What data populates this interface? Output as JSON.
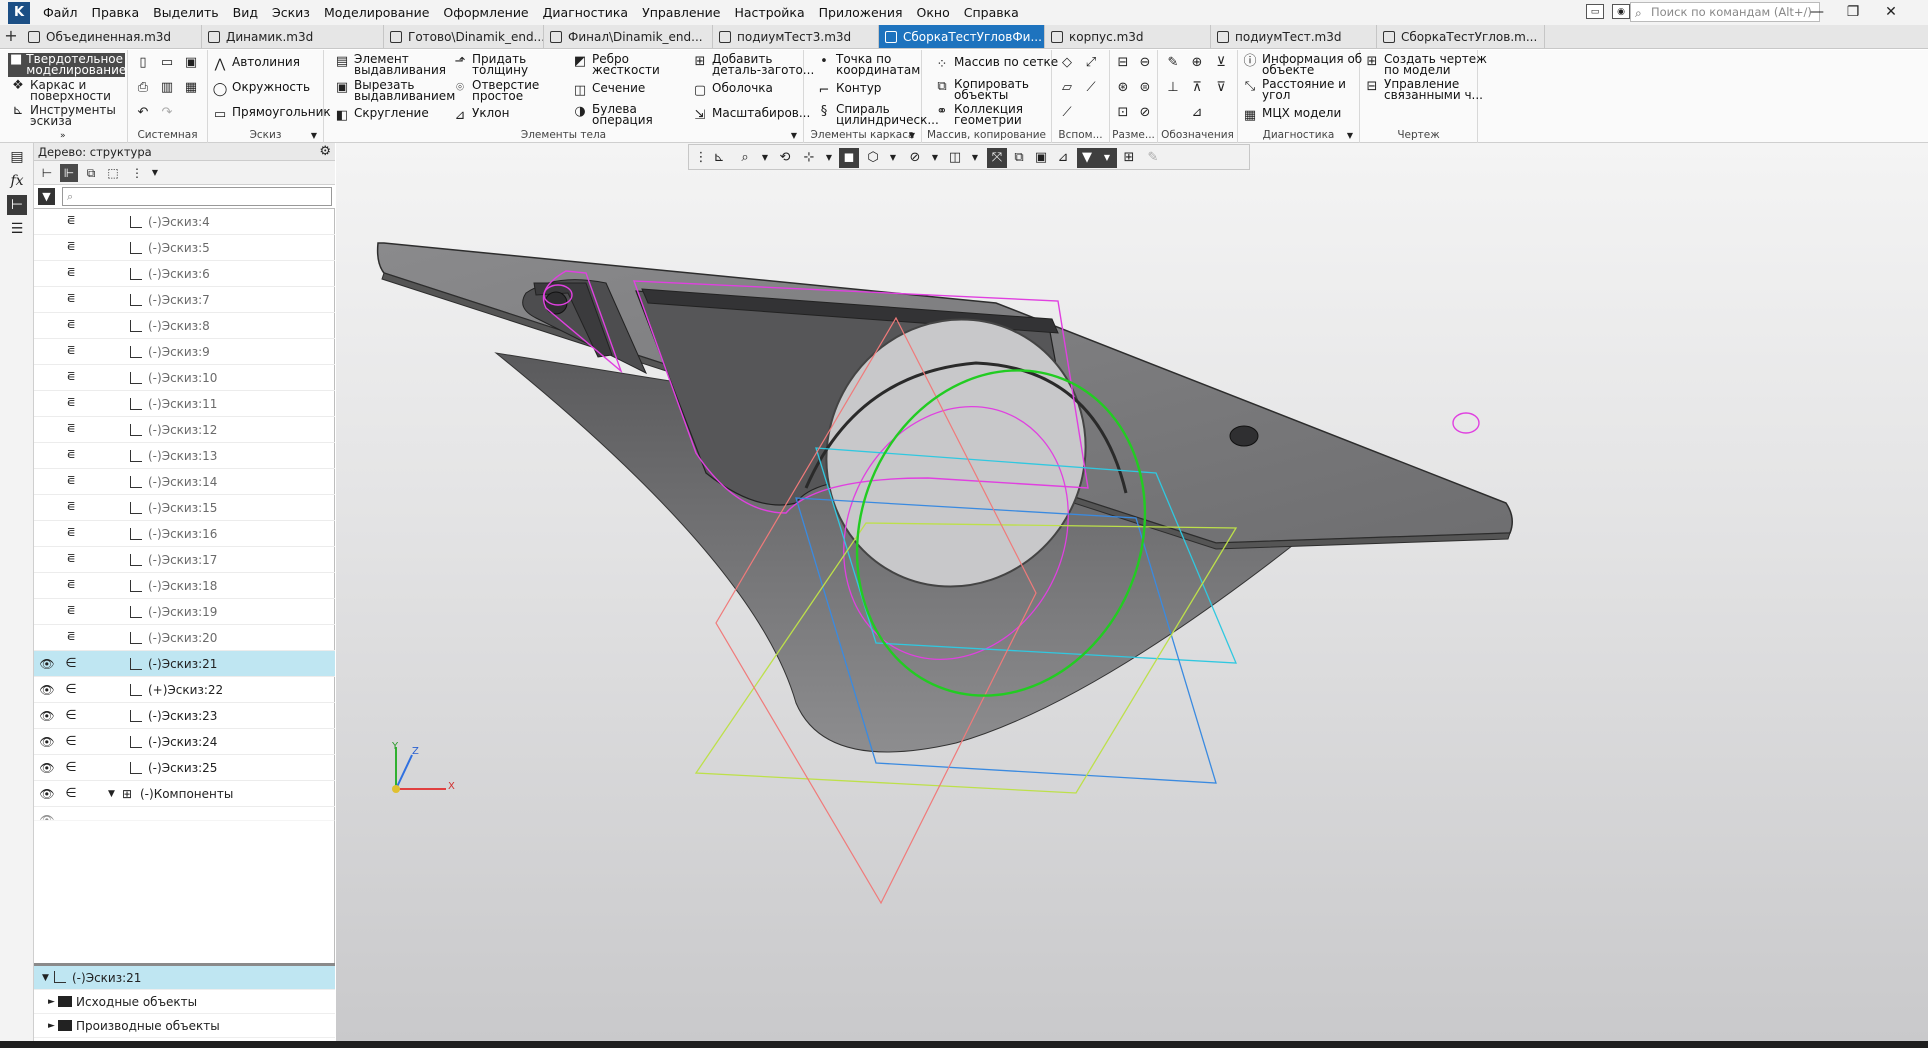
{
  "menu": {
    "items": [
      "Файл",
      "Правка",
      "Выделить",
      "Вид",
      "Эскиз",
      "Моделирование",
      "Оформление",
      "Диагностика",
      "Управление",
      "Настройка",
      "Приложения",
      "Окно",
      "Справка"
    ],
    "search_placeholder": "Поиск по командам (Alt+/)"
  },
  "tabs": [
    {
      "label": "Объединенная.m3d",
      "active": false
    },
    {
      "label": "Динамик.m3d",
      "active": false
    },
    {
      "label": "Готово\\Dinamik_end...",
      "active": false
    },
    {
      "label": "Финал\\Dinamik_end...",
      "active": false
    },
    {
      "label": "подиумТест3.m3d",
      "active": false
    },
    {
      "label": "СборкаТестУгловФи...",
      "active": true
    },
    {
      "label": "корпус.m3d",
      "active": false
    },
    {
      "label": "подиумТест.m3d",
      "active": false
    },
    {
      "label": "СборкаТестУглов.m...",
      "active": false
    }
  ],
  "ribbon": {
    "modes": {
      "solid": [
        "Твердотельное",
        "моделирование"
      ],
      "wire": [
        "Каркас и",
        "поверхности"
      ],
      "sketch_tools": [
        "Инструменты",
        "эскиза"
      ]
    },
    "sketch": {
      "autoline": "Автолиния",
      "circle": "Окружность",
      "rectangle": "Прямоугольник"
    },
    "body": {
      "extrude": [
        "Элемент",
        "выдавливания"
      ],
      "cut_extrude": [
        "Вырезать",
        "выдавливанием"
      ],
      "fillet": "Скругление",
      "thicken": [
        "Придать",
        "толщину"
      ],
      "hole": [
        "Отверстие",
        "простое"
      ],
      "draft": "Уклон",
      "rib": [
        "Ребро",
        "жесткости"
      ],
      "section": "Сечение",
      "boolean": [
        "Булева",
        "операция"
      ],
      "add_blank": [
        "Добавить",
        "деталь-загото..."
      ],
      "shell": "Оболочка",
      "scale": "Масштабиров..."
    },
    "frame": {
      "point": [
        "Точка по",
        "координатам"
      ],
      "contour": "Контур",
      "spiral": [
        "Спираль",
        "цилиндрическ..."
      ]
    },
    "array": {
      "grid": "Массив по сетке",
      "copy": [
        "Копировать",
        "объекты"
      ],
      "collection": [
        "Коллекция",
        "геометрии"
      ]
    },
    "diag": {
      "info": [
        "Информация об",
        "объекте"
      ],
      "distance": [
        "Расстояние и",
        "угол"
      ],
      "mcx": "МЦХ модели"
    },
    "drawing": {
      "create": [
        "Создать чертеж",
        "по модели"
      ],
      "manage": [
        "Управление",
        "связанными ч..."
      ]
    },
    "groups": {
      "system": "Системная",
      "sketch": "Эскиз",
      "body": "Элементы тела",
      "frame": "Элементы каркаса",
      "array": "Массив, копирование",
      "aux": "Вспом...",
      "dim": "Разме...",
      "notation": "Обозначения",
      "diag": "Диагностика",
      "drawing": "Чертеж"
    }
  },
  "tree": {
    "header": "Дерево: структура",
    "search_placeholder": "",
    "items": [
      {
        "label": "(-)Эскиз:4",
        "dim": true
      },
      {
        "label": "(-)Эскиз:5",
        "dim": true
      },
      {
        "label": "(-)Эскиз:6",
        "dim": true
      },
      {
        "label": "(-)Эскиз:7",
        "dim": true
      },
      {
        "label": "(-)Эскиз:8",
        "dim": true
      },
      {
        "label": "(-)Эскиз:9",
        "dim": true
      },
      {
        "label": "(-)Эскиз:10",
        "dim": true
      },
      {
        "label": "(-)Эскиз:11",
        "dim": true
      },
      {
        "label": "(-)Эскиз:12",
        "dim": true
      },
      {
        "label": "(-)Эскиз:13",
        "dim": true
      },
      {
        "label": "(-)Эскиз:14",
        "dim": true
      },
      {
        "label": "(-)Эскиз:15",
        "dim": true
      },
      {
        "label": "(-)Эскиз:16",
        "dim": true
      },
      {
        "label": "(-)Эскиз:17",
        "dim": true
      },
      {
        "label": "(-)Эскиз:18",
        "dim": true
      },
      {
        "label": "(-)Эскиз:19",
        "dim": true
      },
      {
        "label": "(-)Эскиз:20",
        "dim": true
      },
      {
        "label": "(-)Эскиз:21",
        "dim": false,
        "selected": true
      },
      {
        "label": "(+)Эскиз:22",
        "dim": false
      },
      {
        "label": "(-)Эскиз:23",
        "dim": false
      },
      {
        "label": "(-)Эскиз:24",
        "dim": false
      },
      {
        "label": "(-)Эскиз:25",
        "dim": false
      },
      {
        "label": "(-)Компоненты",
        "dim": false,
        "component": true
      }
    ],
    "detail": {
      "root": "(-)Эскиз:21",
      "source": "Исходные объекты",
      "derived": "Производные объекты"
    }
  },
  "triad": {
    "x": "X",
    "y": "Y",
    "z": "Z"
  },
  "colors": {
    "accent": "#1e73be",
    "selection": "#bfe6f2",
    "sketch_magenta": "#e040e0",
    "sketch_green": "#22cc22"
  },
  "icons": [
    "search-icon",
    "gear-icon",
    "filter-icon",
    "eye-icon",
    "sketch-icon",
    "folder-icon",
    "close-icon"
  ]
}
